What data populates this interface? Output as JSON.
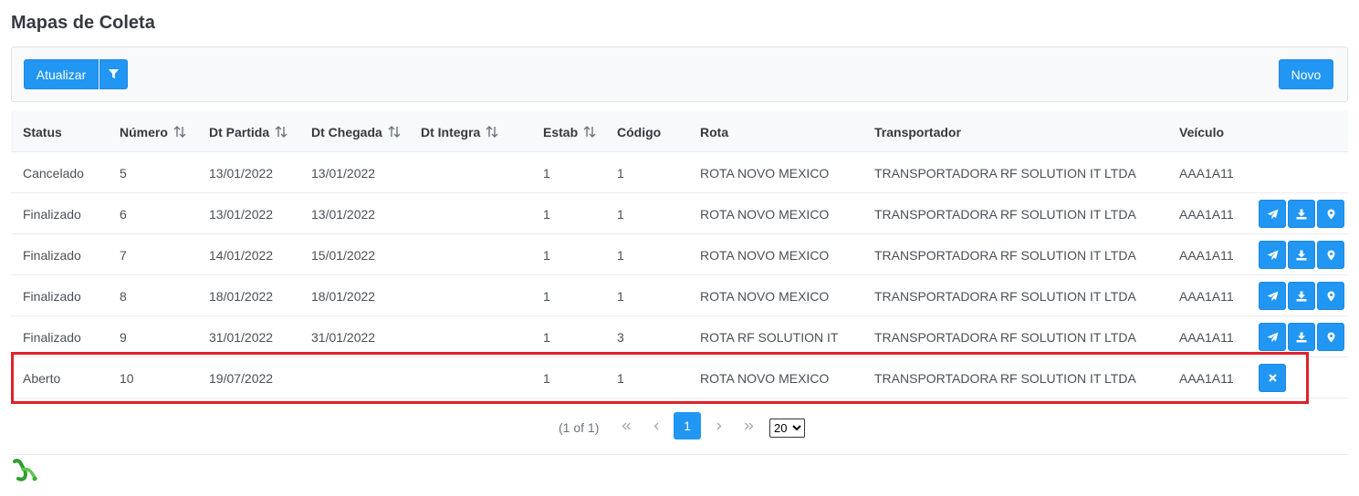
{
  "page": {
    "title": "Mapas de Coleta"
  },
  "toolbar": {
    "refresh_label": "Atualizar",
    "filter_icon": "filter-icon",
    "new_label": "Novo"
  },
  "table": {
    "columns": [
      {
        "label": "Status",
        "sortable": false
      },
      {
        "label": "Número",
        "sortable": true
      },
      {
        "label": "Dt Partida",
        "sortable": true
      },
      {
        "label": "Dt Chegada",
        "sortable": true
      },
      {
        "label": "Dt Integra",
        "sortable": true
      },
      {
        "label": "Estab",
        "sortable": true
      },
      {
        "label": "Código",
        "sortable": false
      },
      {
        "label": "Rota",
        "sortable": false
      },
      {
        "label": "Transportador",
        "sortable": false
      },
      {
        "label": "Veículo",
        "sortable": false
      }
    ],
    "rows": [
      {
        "status": "Cancelado",
        "numero": "5",
        "dt_partida": "13/01/2022",
        "dt_chegada": "13/01/2022",
        "dt_integra": "",
        "estab": "1",
        "codigo": "1",
        "rota": "ROTA NOVO MEXICO",
        "transportador": "TRANSPORTADORA RF SOLUTION IT LTDA",
        "veiculo": "AAA1A11",
        "actions": []
      },
      {
        "status": "Finalizado",
        "numero": "6",
        "dt_partida": "13/01/2022",
        "dt_chegada": "13/01/2022",
        "dt_integra": "",
        "estab": "1",
        "codigo": "1",
        "rota": "ROTA NOVO MEXICO",
        "transportador": "TRANSPORTADORA RF SOLUTION IT LTDA",
        "veiculo": "AAA1A11",
        "actions": [
          "send",
          "download",
          "map-marker"
        ]
      },
      {
        "status": "Finalizado",
        "numero": "7",
        "dt_partida": "14/01/2022",
        "dt_chegada": "15/01/2022",
        "dt_integra": "",
        "estab": "1",
        "codigo": "1",
        "rota": "ROTA NOVO MEXICO",
        "transportador": "TRANSPORTADORA RF SOLUTION IT LTDA",
        "veiculo": "AAA1A11",
        "actions": [
          "send",
          "download",
          "map-marker"
        ]
      },
      {
        "status": "Finalizado",
        "numero": "8",
        "dt_partida": "18/01/2022",
        "dt_chegada": "18/01/2022",
        "dt_integra": "",
        "estab": "1",
        "codigo": "1",
        "rota": "ROTA NOVO MEXICO",
        "transportador": "TRANSPORTADORA RF SOLUTION IT LTDA",
        "veiculo": "AAA1A11",
        "actions": [
          "send",
          "download",
          "map-marker"
        ]
      },
      {
        "status": "Finalizado",
        "numero": "9",
        "dt_partida": "31/01/2022",
        "dt_chegada": "31/01/2022",
        "dt_integra": "",
        "estab": "1",
        "codigo": "3",
        "rota": "ROTA RF SOLUTION IT",
        "transportador": "TRANSPORTADORA RF SOLUTION IT LTDA",
        "veiculo": "AAA1A11",
        "actions": [
          "send",
          "download",
          "map-marker"
        ]
      },
      {
        "status": "Aberto",
        "numero": "10",
        "dt_partida": "19/07/2022",
        "dt_chegada": "",
        "dt_integra": "",
        "estab": "1",
        "codigo": "1",
        "rota": "ROTA NOVO MEXICO",
        "transportador": "TRANSPORTADORA RF SOLUTION IT LTDA",
        "veiculo": "AAA1A11",
        "actions": [
          "close"
        ]
      }
    ]
  },
  "paginator": {
    "report": "(1 of 1)",
    "current_page": "1",
    "rows_per_page": "20",
    "rows_per_page_options": [
      "20"
    ]
  },
  "colors": {
    "primary": "#2196f3",
    "highlight": "#e0202a",
    "logo": "#2e9d2e"
  }
}
